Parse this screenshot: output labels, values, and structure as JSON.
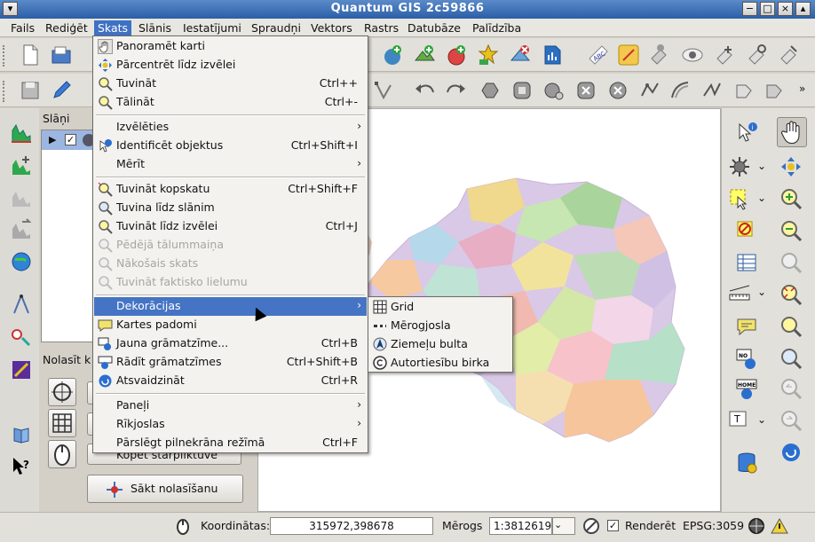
{
  "window": {
    "title": "Quantum GIS 2c59866"
  },
  "menubar": {
    "items": [
      "Fails",
      "Rediģēt",
      "Skats",
      "Slānis",
      "Iestatījumi",
      "Spraudņi",
      "Vektors",
      "Rastrs",
      "Datubāze",
      "Palīdzība"
    ],
    "active": "Skats"
  },
  "view_menu": {
    "items": [
      {
        "label": "Panoramēt karti",
        "shortcut": "",
        "icon": "pan-hand-icon",
        "state": "normal"
      },
      {
        "label": "Pārcentrēt līdz izvēlei",
        "shortcut": "",
        "icon": "pan-to-selection-icon",
        "state": "normal"
      },
      {
        "label": "Tuvināt",
        "shortcut": "Ctrl++",
        "icon": "zoom-in-icon",
        "state": "normal"
      },
      {
        "label": "Tālināt",
        "shortcut": "Ctrl+-",
        "icon": "zoom-out-icon",
        "state": "normal"
      },
      {
        "label": "Izvēlēties",
        "shortcut": "",
        "icon": "",
        "state": "submenu"
      },
      {
        "label": "Identificēt objektus",
        "shortcut": "Ctrl+Shift+I",
        "icon": "identify-icon",
        "state": "normal"
      },
      {
        "label": "Mērīt",
        "shortcut": "",
        "icon": "",
        "state": "submenu"
      },
      {
        "label": "Tuvināt kopskatu",
        "shortcut": "Ctrl+Shift+F",
        "icon": "zoom-full-icon",
        "state": "normal"
      },
      {
        "label": "Tuvina līdz slānim",
        "shortcut": "",
        "icon": "zoom-layer-icon",
        "state": "normal"
      },
      {
        "label": "Tuvināt līdz izvēlei",
        "shortcut": "Ctrl+J",
        "icon": "zoom-selection-icon",
        "state": "normal"
      },
      {
        "label": "Pēdējā tālummaiņa",
        "shortcut": "",
        "icon": "zoom-last-icon",
        "state": "disabled"
      },
      {
        "label": "Nākošais skats",
        "shortcut": "",
        "icon": "zoom-next-icon",
        "state": "disabled"
      },
      {
        "label": "Tuvināt faktisko lielumu",
        "shortcut": "",
        "icon": "zoom-actual-icon",
        "state": "disabled"
      },
      {
        "label": "Dekorācijas",
        "shortcut": "",
        "icon": "",
        "state": "highlighted-submenu"
      },
      {
        "label": "Kartes padomi",
        "shortcut": "",
        "icon": "map-tips-icon",
        "state": "normal"
      },
      {
        "label": "Jauna grāmatzīme...",
        "shortcut": "Ctrl+B",
        "icon": "new-bookmark-icon",
        "state": "normal"
      },
      {
        "label": "Rādīt grāmatzīmes",
        "shortcut": "Ctrl+Shift+B",
        "icon": "show-bookmarks-icon",
        "state": "normal"
      },
      {
        "label": "Atsvaidzināt",
        "shortcut": "Ctrl+R",
        "icon": "refresh-icon",
        "state": "normal"
      },
      {
        "label": "Paneļi",
        "shortcut": "",
        "icon": "",
        "state": "submenu"
      },
      {
        "label": "Rīkjoslas",
        "shortcut": "",
        "icon": "",
        "state": "submenu"
      },
      {
        "label": "Pārslēgt pilnekrāna režīmā",
        "shortcut": "Ctrl+F",
        "icon": "",
        "state": "normal"
      }
    ]
  },
  "decorations_submenu": {
    "items": [
      {
        "label": "Grid",
        "icon": "grid-icon"
      },
      {
        "label": "Mērogjosla",
        "icon": "scale-bar-icon"
      },
      {
        "label": "Ziemeļu bulta",
        "icon": "north-arrow-icon"
      },
      {
        "label": "Autortiesību birka",
        "icon": "copyright-icon"
      }
    ]
  },
  "layers_panel": {
    "title": "Slāņi"
  },
  "capture_panel": {
    "title": "Nolasīt k",
    "copy_label": "Kopēt starpliktuvē",
    "start_label": "Sākt nolasīšanu"
  },
  "status": {
    "coord_label": "Koordinātas:",
    "coord_value": "315972,398678",
    "scale_label": "Mērogs",
    "scale_value": "1:3812619",
    "render_label": "Renderēt",
    "render_checked": true,
    "crs": "EPSG:3059"
  },
  "colors": {
    "accent": "#4574c4",
    "menu_bg": "#f3f2ef"
  }
}
